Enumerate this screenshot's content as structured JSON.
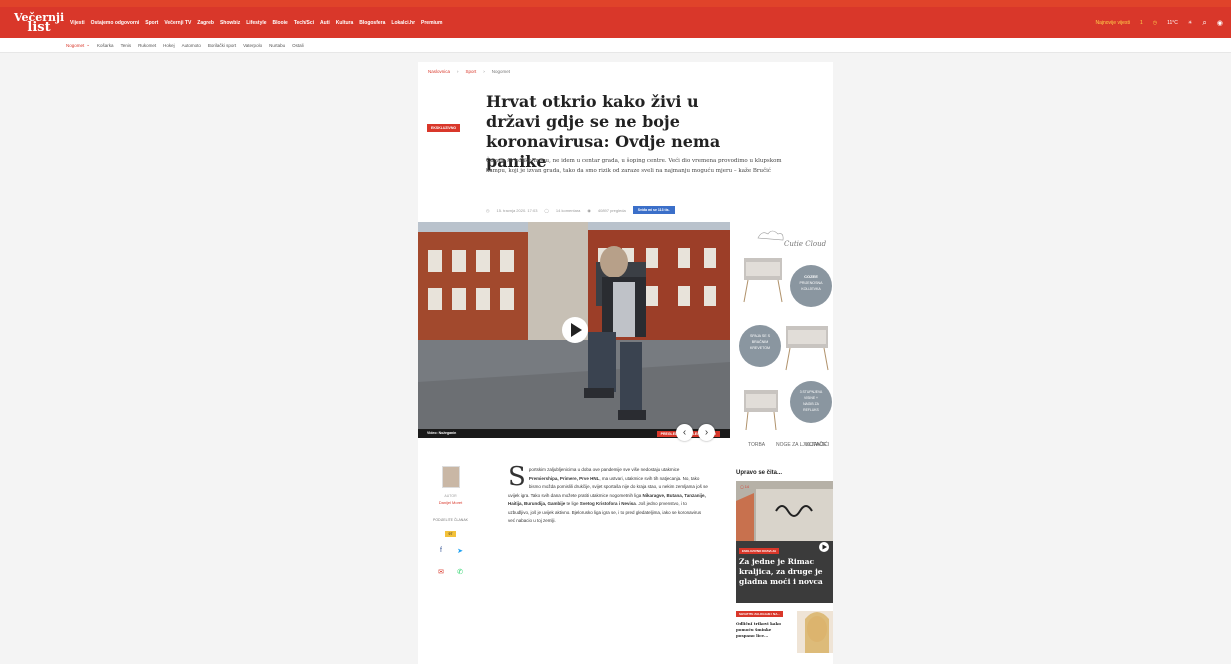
{
  "brand": {
    "logo_line1": "Večernji",
    "logo_line2": "list",
    "accent": "#d9372a"
  },
  "nav": {
    "links": [
      "Vijesti",
      "Ostajemo odgovorni",
      "Sport",
      "Večernji TV",
      "Zagreb",
      "Showbiz",
      "Lifestyle",
      "Blooie",
      "Tech/Sci",
      "Auti",
      "Kultura",
      "Blogosfera",
      "Lokalci.hr",
      "Premium"
    ],
    "right_label": "Najnovije vijesti",
    "right_count": "1",
    "right_temp": "11°C"
  },
  "subnav": {
    "items": [
      "Nogomet",
      "Košarka",
      "Tenis",
      "Rukomet",
      "Hokej",
      "Automoto",
      "Borilački sport",
      "Vaterpolo",
      "Nurtabu",
      "Ostali"
    ]
  },
  "breadcrumb": [
    "Naslovnica",
    "Sport",
    "Nogomet"
  ],
  "article": {
    "badge": "EKSKLUZIVNO",
    "title": "Hrvat otkrio kako živi u državi gdje se ne boje koronavirusa: Ovdje nema panike",
    "lead": "Čuvam se koliko mogu, ne idem u centar grada, u šoping centre. Veći dio vremena provodimo u klupskom kampu, koji je izvan grada, tako da smo rizik od zaraze sveli na najmanju moguću mjeru – kaže Bručić",
    "date": "15. travnja 2020. 17:03",
    "comments": "14 komentara",
    "views": "40897 pregleda",
    "share_label": "Sviđa mi se 113 tis.",
    "video_caption": "Video: Nožeganin",
    "video_tag": "PREGLEDAJTE GALERIJU 1",
    "video_tag_count": "69"
  },
  "ad": {
    "brand": "Cutie Cloud",
    "bubble1": "COZEE PRIJENOSNA KOLIJEVKA",
    "bubble2": "SPAJA SE S BRAČNIM KREVETOM",
    "bubble3": "3 STUPNJEVA VISINE + NAGIB ZA REFLUKS",
    "label1": "TORBA",
    "label2": "NOGE ZA LJULJANJE",
    "label3": "KOTAČIĆI"
  },
  "author": {
    "label": "AUTOR",
    "name": "Danijel Moret",
    "share_label": "PODIJELITE ČLANAK",
    "share_count": "97"
  },
  "body": {
    "dropcap": "S",
    "p1": "portskim zaljubljenicima u doba ove pandemije sve više nedostaju utakmice",
    "bold1": "Premiershipa, Primere, Prve HNL",
    "p2": ", ma ustvari, utakmice svih tih natjecanja. No, tako bismo možda pomislili drukčije, svijet sportaša nije do kraja stao, u nekim zemljama još se uvijek igra. Tako svih dana možete pratiti utakmice nogometnih liga",
    "bold2": "Nikaragve, Butana, Tanzanije, Haitija, Burundija, Gambije",
    "p3": " te lige ",
    "bold3": "Svetog Kristofora i Nevisa",
    "p4": ". Još jedno prvenstvo, i to uzbudljivo, još je uvijek aktivno. Bjelorusko liga igra se, i to pred gledateljima, iako se koronavirus već nabacio u toj zemlji."
  },
  "sidebar": {
    "heading": "Upravo se čita...",
    "card_badge": "ESKLUZIVNO KRAVLJA",
    "card_title": "Za jedne je Rimac kraljica, za druge je gladna moći i novca",
    "card_count": "14",
    "mini_badge": "SHVATITE ZALOGAJE I NA...",
    "mini_title": "OdličnI trikovi kako pomoću šminke pospano lice..."
  }
}
